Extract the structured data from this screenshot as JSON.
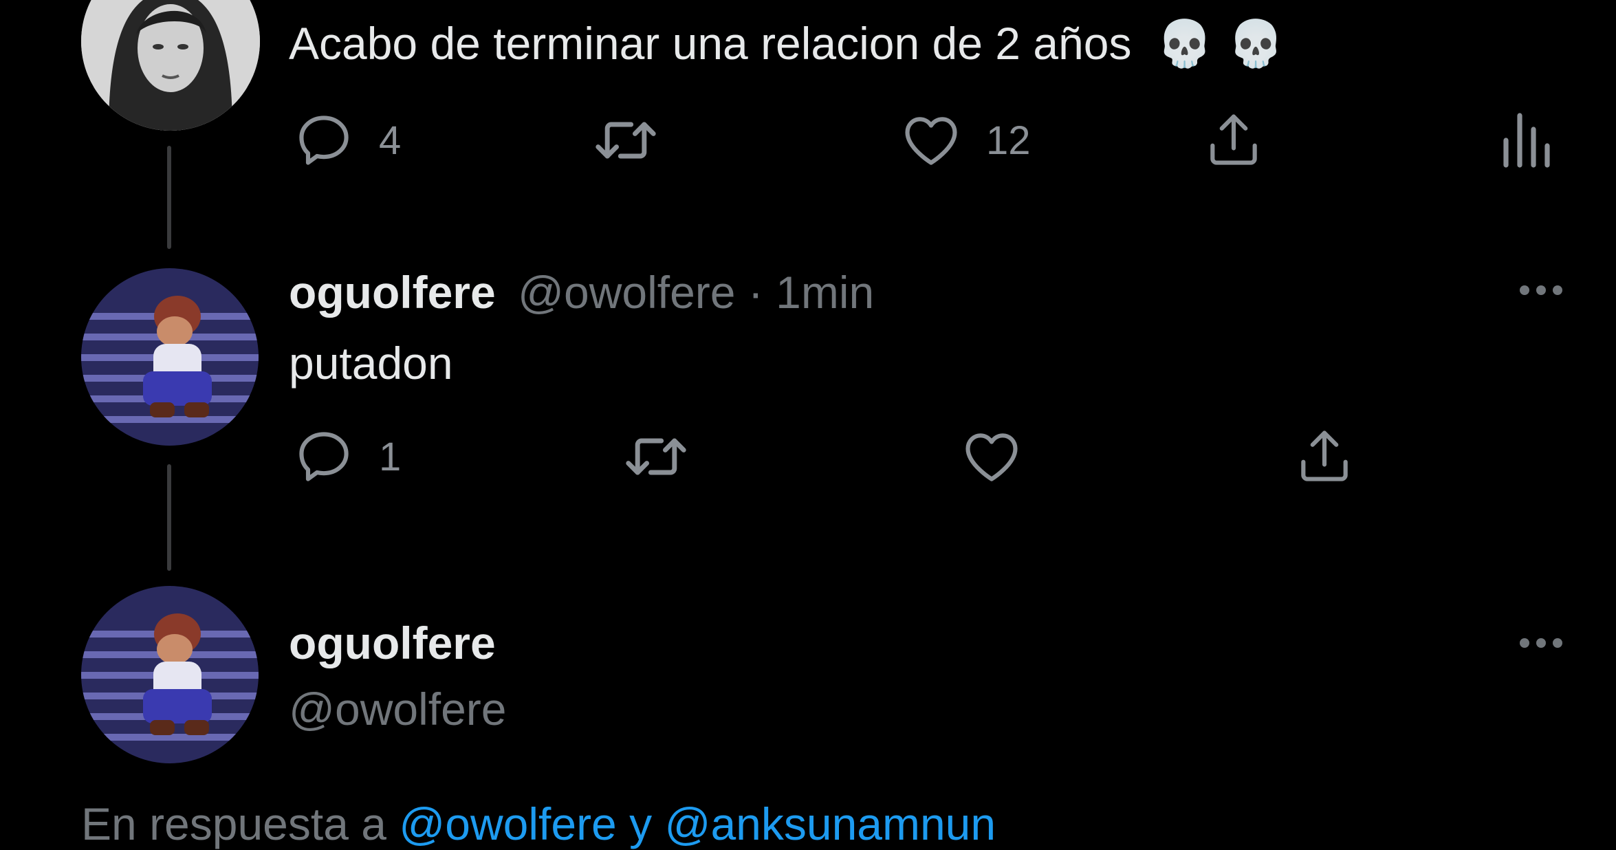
{
  "tweet1": {
    "text": "Acabo de terminar una relacion de 2 años",
    "emoji": "💀 💀",
    "reply_count": "4",
    "retweet_count": "",
    "like_count": "12"
  },
  "tweet2": {
    "display_name": "oguolfere",
    "handle": "@owolfere",
    "separator": "·",
    "time": "1min",
    "text": "putadon",
    "reply_count": "1",
    "retweet_count": "",
    "like_count": ""
  },
  "tweet3": {
    "display_name": "oguolfere",
    "handle": "@owolfere"
  },
  "reply_context": {
    "prefix": "En respuesta a",
    "user1": "@owolfere",
    "conjunction": "y",
    "user2": "@anksunamnun"
  },
  "icons": {
    "reply": "reply-icon",
    "retweet": "retweet-icon",
    "like": "heart-icon",
    "share": "share-icon",
    "analytics": "analytics-icon",
    "more": "more-icon"
  },
  "colors": {
    "background": "#000000",
    "text": "#e7e9ea",
    "secondary": "#71767b",
    "link": "#1d9bf0",
    "thread_line": "#3a3b3d"
  }
}
